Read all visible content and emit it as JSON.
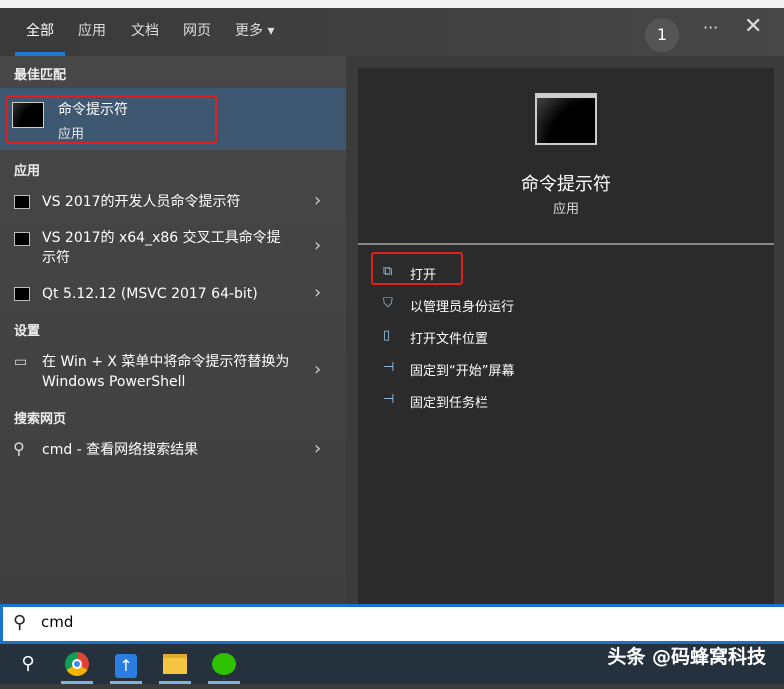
{
  "tabs": [
    "全部",
    "应用",
    "文档",
    "网页",
    "更多 ▾"
  ],
  "badge": "1",
  "more_icon": "···",
  "close_icon": "✕",
  "sections": {
    "best": "最佳匹配",
    "apps": "应用",
    "settings": "设置",
    "web": "搜索网页"
  },
  "best_match": {
    "title": "命令提示符",
    "subtitle": "应用"
  },
  "apps": [
    "VS 2017的开发人员命令提示符",
    "VS 2017的 x64_x86 交叉工具命令提示符",
    "Qt 5.12.12 (MSVC 2017 64-bit)"
  ],
  "settings": [
    "在 Win + X 菜单中将命令提示符替换为 Windows PowerShell"
  ],
  "web": [
    "cmd - 查看网络搜索结果"
  ],
  "detail": {
    "title": "命令提示符",
    "subtitle": "应用"
  },
  "actions": [
    "打开",
    "以管理员身份运行",
    "打开文件位置",
    "固定到“开始”屏幕",
    "固定到任务栏"
  ],
  "search": {
    "value": "cmd"
  },
  "watermark": "头条 @码蜂窝科技",
  "background_text": "...",
  "colors": {
    "accent": "#1a73c8",
    "highlight": "#e02020"
  }
}
